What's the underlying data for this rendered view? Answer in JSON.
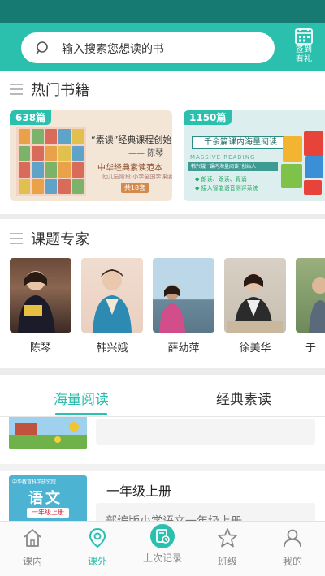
{
  "colors": {
    "accent": "#2bbfae",
    "status_bar": "#167a72",
    "text": "#333333",
    "muted": "#888888"
  },
  "search": {
    "placeholder": "输入搜索您想读的书"
  },
  "signin": {
    "line1": "签到",
    "line2": "有礼",
    "icon": "calendar-icon"
  },
  "hot_books": {
    "title": "热门书籍",
    "items": [
      {
        "badge": "638篇",
        "headline": "“素读”经典课程创始人",
        "author": "—— 陈琴",
        "subtitle": "中华经典素读范本",
        "small": "幼儿园阶段·小学全国学课读本",
        "count": "共18套"
      },
      {
        "badge": "1150篇",
        "headline": "千余篇课内海量阅读",
        "tagline": "MASSIVE READING",
        "strip": "韩兴娥 “课内海量阅读”创始人",
        "bullets": [
          "◆ 朗读、跟读、背诵",
          "◆ 接入智能语音测评系统"
        ]
      }
    ]
  },
  "experts": {
    "title": "课题专家",
    "items": [
      {
        "name": "陈琴"
      },
      {
        "name": "韩兴娥"
      },
      {
        "name": "薛幼萍"
      },
      {
        "name": "徐美华"
      },
      {
        "name": "于"
      }
    ]
  },
  "tabs": [
    {
      "label": "海量阅读",
      "active": true
    },
    {
      "label": "经典素读",
      "active": false
    }
  ],
  "list": [
    {
      "title": "",
      "description": ""
    },
    {
      "thumb_publisher": "中华教育科学研究院",
      "thumb_title": "语文",
      "thumb_grade": "一年级上册",
      "title": "一年级上册",
      "description": "部编版小学语文一年级上册"
    }
  ],
  "bottom_nav": [
    {
      "label": "课内",
      "icon": "home-icon",
      "active": false
    },
    {
      "label": "课外",
      "icon": "location-pin-icon",
      "active": true
    },
    {
      "label": "上次记录",
      "icon": "history-record-icon",
      "active": false
    },
    {
      "label": "班级",
      "icon": "star-icon",
      "active": false
    },
    {
      "label": "我的",
      "icon": "user-icon",
      "active": false
    }
  ]
}
